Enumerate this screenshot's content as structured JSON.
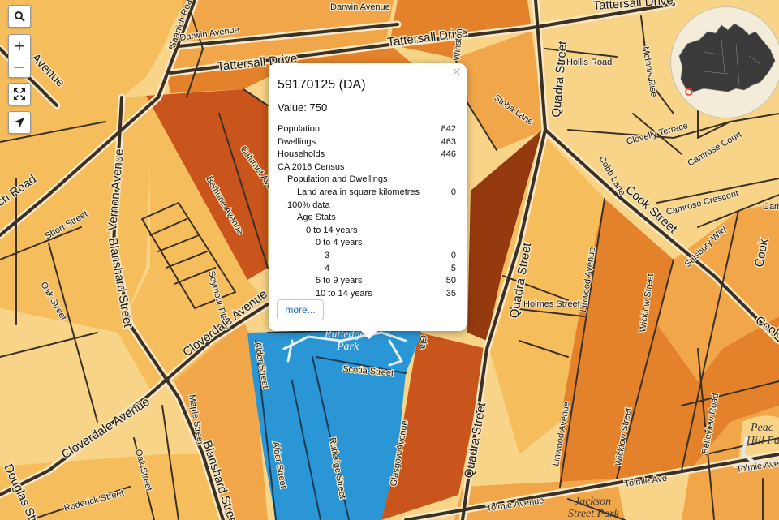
{
  "controls": {
    "search_icon": "search-icon",
    "zoom_in": "+",
    "zoom_out": "−",
    "fullscreen_icon": "fullscreen-icon",
    "locate_icon": "locate-arrow-icon"
  },
  "colors": {
    "light_tan": "#f7d487",
    "orange_mid": "#f2a64a",
    "orange_light": "#f5bd5c",
    "orange_dark": "#e3822b",
    "burnt": "#c9541c",
    "brown": "#953a0f",
    "selected_blue": "#2a96d6",
    "road": "#3b3025",
    "road_casing": "#f8e8c6"
  },
  "street_labels": [
    "Saanich Road",
    "Darwin Avenue",
    "Darwin Avenue",
    "Tattersall Drive",
    "Tattersall Drive",
    "Tattersall Drive",
    "Winston",
    "Quadra Street",
    "Hollis Road",
    "McInnis Rise",
    "Stoba Lane",
    "Clovelly Terrace",
    "Camrose Court",
    "Calumet Avenue",
    "Bethune Avenue",
    "Cobb Lane",
    "Cook Street",
    "Camrose Crescent",
    "Cam",
    "Vernon Avenue",
    "Blanshard Street",
    "Short Street",
    "Oak Street",
    "Seymour Place",
    "Cloverdale Avenue",
    "Salsbury Way",
    "Quadra Street",
    "Holmes Street",
    "Linwood Avenue",
    "Wicklow Street",
    "Cook",
    "Alder Street",
    "Scotia Street",
    "Gla",
    "Maple Street",
    "Cloverdale Avenue",
    "Oak Street",
    "Blanshard Street",
    "Roderick Street",
    "Douglas Street",
    "Alder Street",
    "Rutledge Street",
    "Glasgow Avenue",
    "Quadra Street",
    "Linwood Avenue",
    "Wicklow Street",
    "Belleview Road",
    "Tolmie Avenue",
    "Tolmie Ave",
    "Tolmie Avenue",
    "Avenue",
    "ch Road",
    "Cook"
  ],
  "park_labels": {
    "rutledge": "Rutledge",
    "rutledge_park": "Park",
    "jackson1": "Jackson",
    "jackson2": "Street Park",
    "peace1": "Peac",
    "peace2": "Hill Par"
  },
  "popup": {
    "title": "59170125 (DA)",
    "value": "Value: 750",
    "rows": [
      {
        "label": "Population",
        "value": "842",
        "indent": 0
      },
      {
        "label": "Dwellings",
        "value": "463",
        "indent": 0
      },
      {
        "label": "Households",
        "value": "446",
        "indent": 0
      },
      {
        "label": "CA 2016 Census",
        "value": "",
        "indent": 0
      },
      {
        "label": "Population and Dwellings",
        "value": "",
        "indent": 1
      },
      {
        "label": "Land area in square kilometres",
        "value": "0",
        "indent": 2
      },
      {
        "label": "100% data",
        "value": "",
        "indent": 1
      },
      {
        "label": "Age Stats",
        "value": "",
        "indent": 2
      },
      {
        "label": "0 to 14 years",
        "value": "",
        "indent": 3
      },
      {
        "label": "0 to 4 years",
        "value": "",
        "indent": 4
      },
      {
        "label": "3",
        "value": "0",
        "indent": 5
      },
      {
        "label": "4",
        "value": "5",
        "indent": 5
      },
      {
        "label": "5 to 9 years",
        "value": "50",
        "indent": 4
      },
      {
        "label": "10 to 14 years",
        "value": "35",
        "indent": 4
      }
    ],
    "more_label": "more...",
    "close_label": "×"
  }
}
